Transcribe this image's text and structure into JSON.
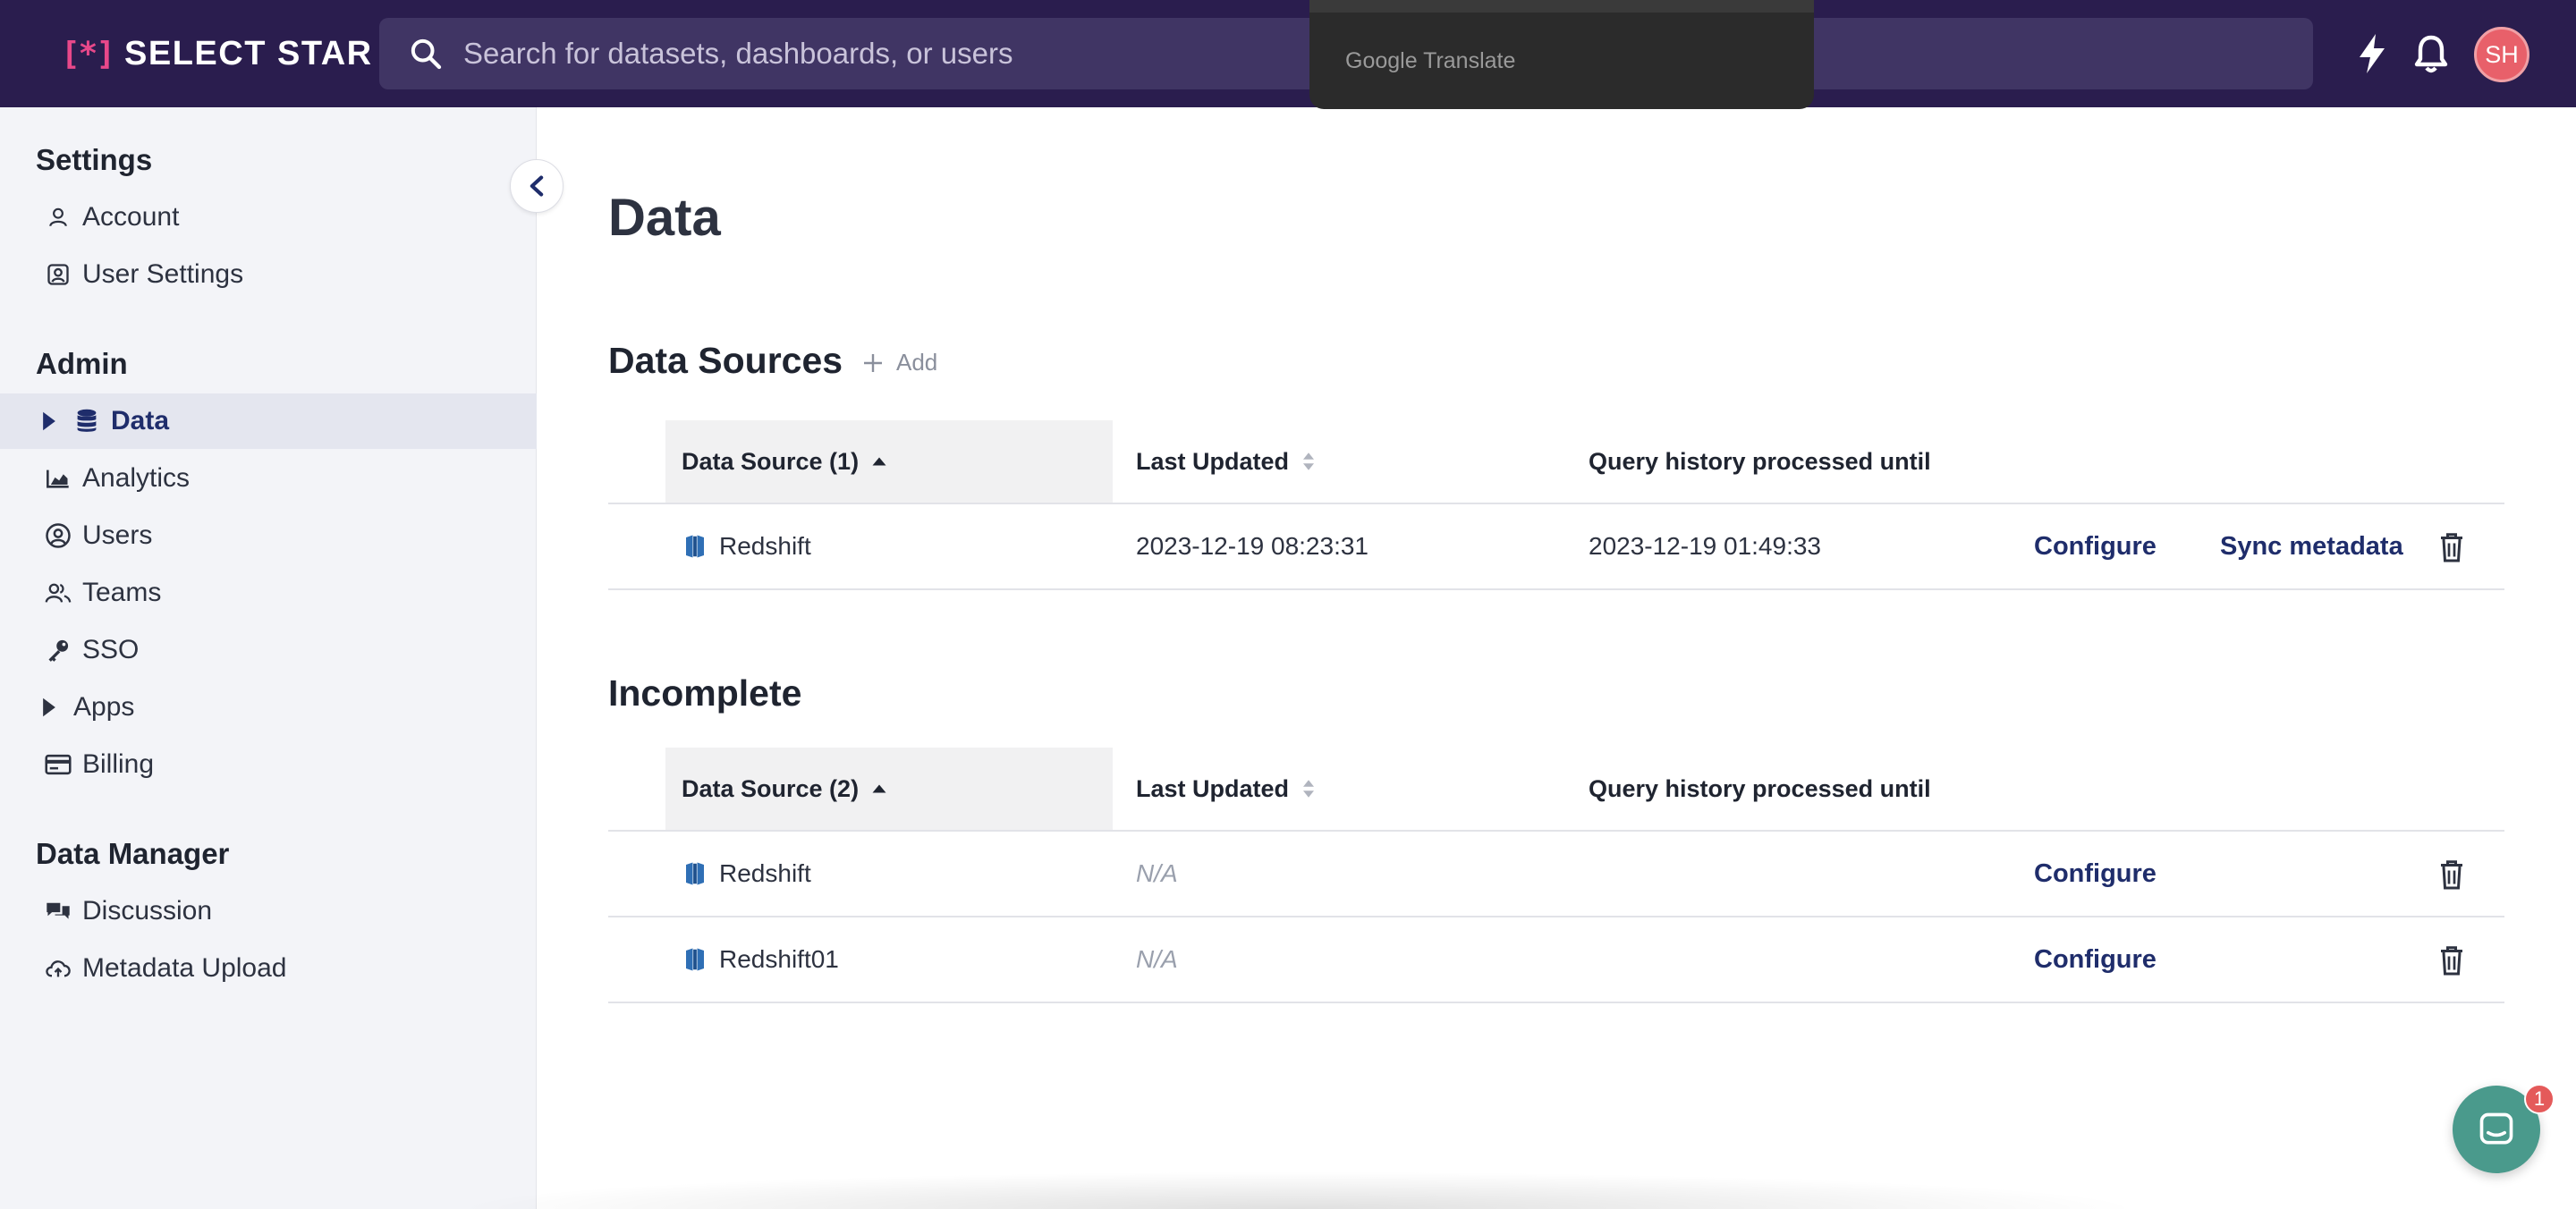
{
  "app": {
    "logo_text": "SELECT STAR",
    "logo_mark": "[*]",
    "search_placeholder": "Search for datasets, dashboards, or users",
    "translate_label": "Google Translate",
    "avatar_initials": "SH",
    "brand_color": "#2a1d4e",
    "accent_color": "#e8488a"
  },
  "sidebar": {
    "settings_heading": "Settings",
    "settings_items": [
      {
        "label": "Account",
        "icon": "person-icon"
      },
      {
        "label": "User Settings",
        "icon": "user-card-icon"
      }
    ],
    "admin_heading": "Admin",
    "admin_items": [
      {
        "label": "Data",
        "icon": "database-icon",
        "active": true,
        "expandable": true
      },
      {
        "label": "Analytics",
        "icon": "chart-icon"
      },
      {
        "label": "Users",
        "icon": "user-circle-icon"
      },
      {
        "label": "Teams",
        "icon": "team-icon"
      },
      {
        "label": "SSO",
        "icon": "key-icon"
      },
      {
        "label": "Apps",
        "icon": "caret-right-icon",
        "expandable": true
      },
      {
        "label": "Billing",
        "icon": "credit-card-icon"
      }
    ],
    "data_manager_heading": "Data Manager",
    "data_manager_items": [
      {
        "label": "Discussion",
        "icon": "chat-bubbles-icon"
      },
      {
        "label": "Metadata Upload",
        "icon": "cloud-upload-icon"
      }
    ]
  },
  "main": {
    "page_title": "Data",
    "data_sources": {
      "title": "Data Sources",
      "add_label": "Add",
      "columns": [
        "Data Source (1)",
        "Last Updated",
        "Query history processed until"
      ],
      "rows": [
        {
          "name": "Redshift",
          "last_updated": "2023-12-19 08:23:31",
          "query_history": "2023-12-19 01:49:33",
          "configure": "Configure",
          "sync": "Sync metadata"
        }
      ]
    },
    "incomplete": {
      "title": "Incomplete",
      "columns": [
        "Data Source (2)",
        "Last Updated",
        "Query history processed until"
      ],
      "rows": [
        {
          "name": "Redshift",
          "last_updated": "N/A",
          "configure": "Configure"
        },
        {
          "name": "Redshift01",
          "last_updated": "N/A",
          "configure": "Configure"
        }
      ]
    }
  },
  "chat": {
    "badge_count": "1"
  }
}
